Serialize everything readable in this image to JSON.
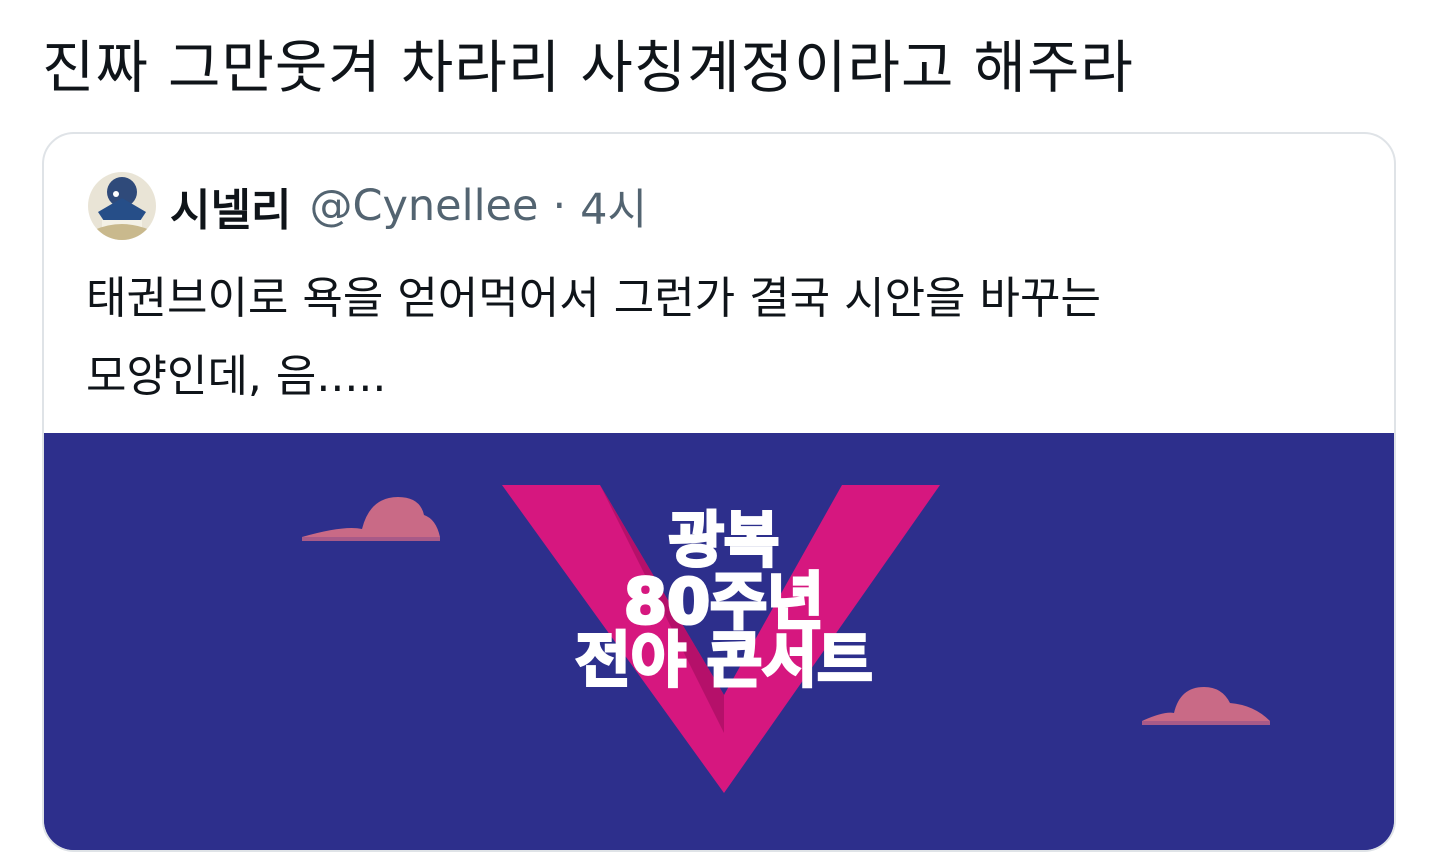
{
  "tweet": {
    "text": "진짜 그만웃겨 차라리 사칭계정이라고 해주라"
  },
  "quoted_tweet": {
    "display_name": "시넬리",
    "handle": "@Cynellee",
    "separator": "·",
    "timestamp": "4시",
    "body_line1": "태권브이로 욕을 얻어먹어서 그런가 결국 시안을 바꾸는",
    "body_line2": "모양인데, 음.....",
    "media": {
      "poster_line1": "광복",
      "poster_line2": "80주년",
      "poster_line3": "전야 콘서트",
      "background_color": "#2d2f8c",
      "accent_color": "#d6177f"
    }
  }
}
